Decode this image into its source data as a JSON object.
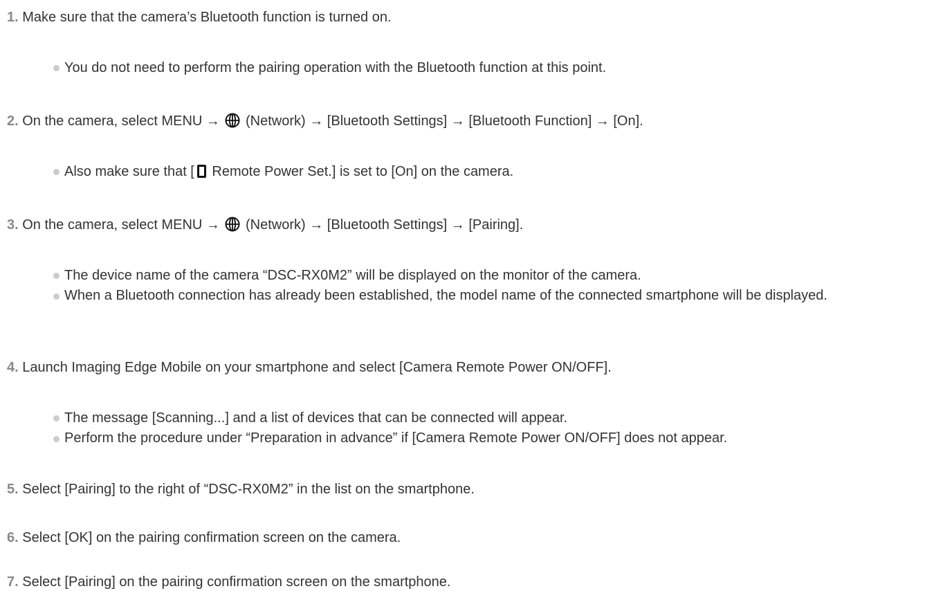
{
  "steps": [
    {
      "number": "1.",
      "text": " Make sure that the camera’s Bluetooth function is turned on.",
      "bullets": [
        "You do not need to perform the pairing operation with the Bluetooth function at this point."
      ]
    },
    {
      "number": "2.",
      "text_before_icon": " On the camera, select MENU → ",
      "icon": "network-globe-icon",
      "text_after_icon": " (Network) → [Bluetooth Settings] → [Bluetooth Function] → [On].",
      "bullets": [
        {
          "before_icon": "Also make sure that [",
          "icon": "remote-power-icon",
          "after_icon": " Remote Power Set.] is set to [On] on the camera."
        }
      ]
    },
    {
      "number": "3.",
      "text_before_icon": " On the camera, select MENU → ",
      "icon": "network-globe-icon",
      "text_after_icon": " (Network) → [Bluetooth Settings] → [Pairing].",
      "bullets": [
        "The device name of the camera “DSC-RX0M2” will be displayed on the monitor of the camera.",
        "When a Bluetooth connection has already been established, the model name of the connected smartphone will be displayed."
      ]
    },
    {
      "number": "4.",
      "text": " Launch Imaging Edge Mobile on your smartphone and select [Camera Remote Power ON/OFF].",
      "bullets": [
        "The message [Scanning...] and a list of devices that can be connected will appear.",
        "Perform the procedure under “Preparation in advance” if [Camera Remote Power ON/OFF] does not appear."
      ]
    },
    {
      "number": "5.",
      "text": " Select [Pairing] to the right of “DSC-RX0M2” in the list on the smartphone."
    },
    {
      "number": "6.",
      "text": " Select [OK] on the pairing confirmation screen on the camera."
    },
    {
      "number": "7.",
      "text": " Select [Pairing] on the pairing confirmation screen on the smartphone."
    }
  ],
  "colors": {
    "text": "#333333",
    "step_number": "#888888",
    "bullet": "#cccccc"
  }
}
